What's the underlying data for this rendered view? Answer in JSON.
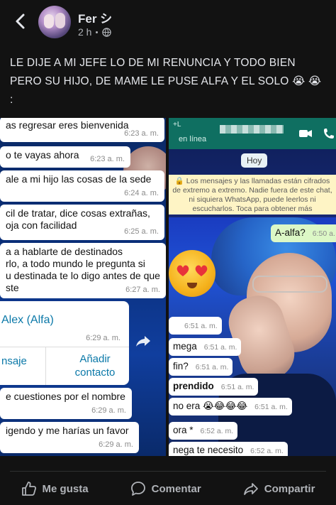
{
  "post": {
    "author": "Fer シ",
    "time": "2 h",
    "caption": "LE DIJE A MI JEFE LO DE MI RENUNCIA Y TODO BIEN PERO SU HIJO, DE MAME LE PUSE ALFA Y EL SOLO 😭 😭 :"
  },
  "left_chat": {
    "messages": [
      {
        "text": "as regresar eres bienvenida",
        "time": "6:23 a. m."
      },
      {
        "text": "o te vayas ahora",
        "time": "6:23 a. m."
      },
      {
        "text": "ale a mi hijo las cosas de la sede",
        "time": "6:24 a. m."
      },
      {
        "text": "cil de tratar, dice cosas extrañas,\noja con facilidad",
        "time": "6:25 a. m."
      },
      {
        "text": "a a hablarte de destinados\nrlo, a todo mundo le pregunta si\nu destinada te lo digo antes de que\nste",
        "time": "6:27 a. m."
      },
      {
        "text": "e cuestiones por el nombre",
        "time": "6:29 a. m."
      },
      {
        "text": "igendo y me harías un favor",
        "time": "6:29 a. m."
      }
    ],
    "contact_card": {
      "name": "Alex (Alfa)",
      "time": "6:29 a. m.",
      "button_message": "nsaje",
      "button_add": "Añadir contacto"
    }
  },
  "right_chat": {
    "status_bar": "+L",
    "subtitle": "en línea",
    "date_chip": "Hoy",
    "encryption_notice": "🔒 Los mensajes y las llamadas están cifrados de extremo a extremo. Nadie fuera de este chat, ni siquiera WhatsApp, puede leerlos ni escucharlos. Toca para obtener más información.",
    "outgoing": {
      "text": "A-alfa?",
      "time": "6:50 a."
    },
    "messages": [
      {
        "text": "",
        "time": "6:51 a. m."
      },
      {
        "text": "mega",
        "time": "6:51 a. m."
      },
      {
        "text": "fin?",
        "time": "6:51 a. m."
      },
      {
        "text": "prendido",
        "time": "6:51 a. m."
      },
      {
        "text": "no era 😭😂😂😂",
        "time": "6:51 a. m."
      },
      {
        "text": "ora *",
        "time": "6:52 a. m."
      },
      {
        "text": "nega te necesito",
        "time": "6:52 a. m."
      }
    ]
  },
  "actions": {
    "like": "Me gusta",
    "comment": "Comentar",
    "share": "Compartir"
  },
  "icons": [
    "back-arrow-icon",
    "globe-icon",
    "video-call-icon",
    "phone-icon",
    "share-arrow-icon",
    "thumbs-up-icon",
    "comment-bubble-icon",
    "share-icon",
    "heart-eyes-emoji"
  ],
  "colors": {
    "background": "#121212",
    "text": "#e4e6eb",
    "secondary": "#b0b3b8",
    "whatsapp_bar": "#0f6f61",
    "link": "#0a78a8"
  }
}
